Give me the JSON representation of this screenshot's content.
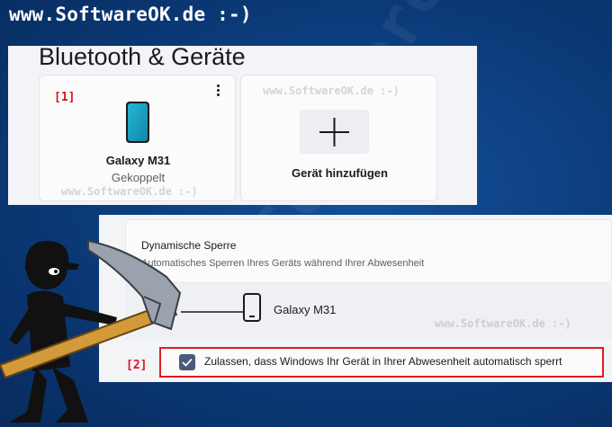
{
  "site": {
    "title": "www.SoftwareOK.de :-)",
    "watermark_small": "www.SoftwareOK.de :-)",
    "watermark_big": "SoftwareOK.de"
  },
  "bluetooth_page": {
    "title": "Bluetooth & Geräte",
    "device_card": {
      "tag": "[1]",
      "name": "Galaxy M31",
      "status": "Gekoppelt",
      "icon": "phone-icon",
      "more_icon": "more-vertical-icon"
    },
    "add_card": {
      "label": "Gerät hinzufügen",
      "icon": "plus-icon"
    }
  },
  "dynamic_lock": {
    "title": "Dynamische Sperre",
    "subtitle": "Automatisches Sperren Ihres Geräts während Ihrer Abwesenheit",
    "device_name": "Galaxy M31",
    "tag": "[2]",
    "allow_label": "Zulassen, dass Windows Ihr Gerät in Ihrer Abwesenheit automatisch sperrt",
    "allow_checked": true
  },
  "colors": {
    "background": "#0b3a78",
    "phone_screen": "#1aa6c9",
    "highlight_red": "#e01c24",
    "checkbox_fill": "#4a5a7c"
  }
}
